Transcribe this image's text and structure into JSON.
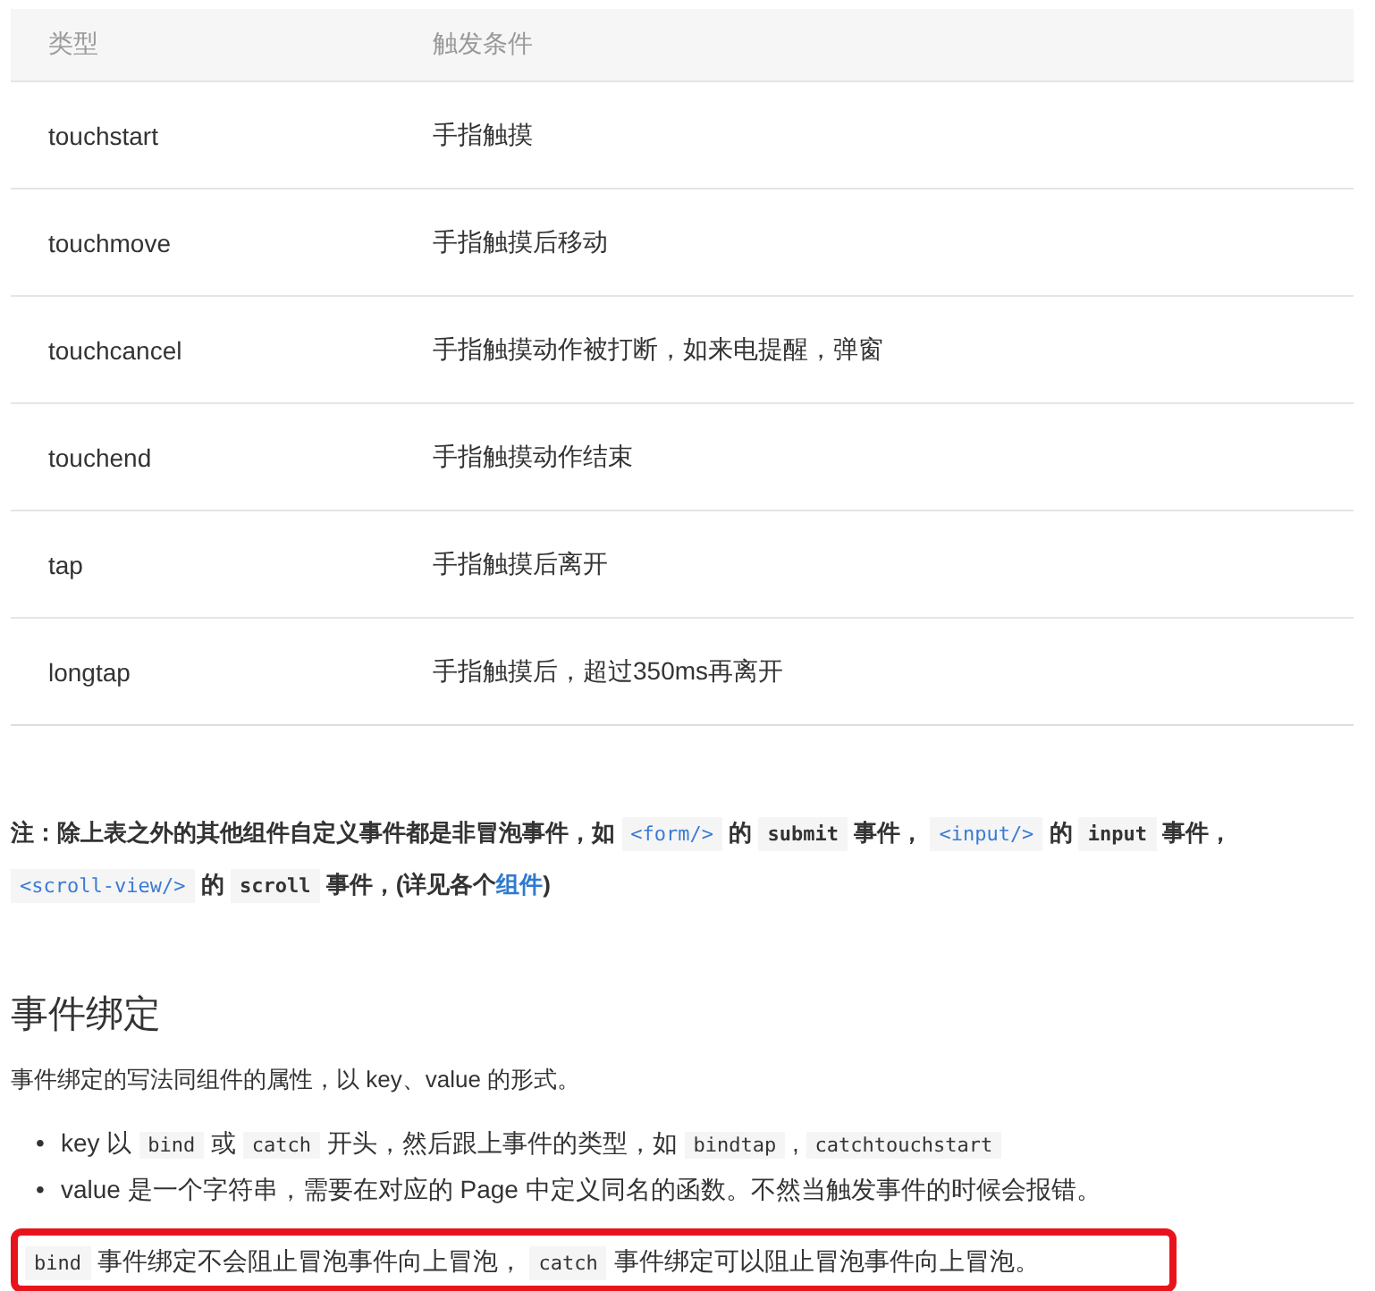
{
  "table": {
    "columns": [
      "类型",
      "触发条件"
    ],
    "rows": [
      [
        "touchstart",
        "手指触摸"
      ],
      [
        "touchmove",
        "手指触摸后移动"
      ],
      [
        "touchcancel",
        "手指触摸动作被打断，如来电提醒，弹窗"
      ],
      [
        "touchend",
        "手指触摸动作结束"
      ],
      [
        "tap",
        "手指触摸后离开"
      ],
      [
        "longtap",
        "手指触摸后，超过350ms再离开"
      ]
    ]
  },
  "note": [
    {
      "kind": "text",
      "text": "注：除上表之外的其他组件自定义事件都是非冒泡事件，如 "
    },
    {
      "kind": "tag",
      "text": "<form/>"
    },
    {
      "kind": "text",
      "text": " 的 "
    },
    {
      "kind": "code",
      "text": "submit"
    },
    {
      "kind": "text",
      "text": " 事件， "
    },
    {
      "kind": "tag",
      "text": "<input/>"
    },
    {
      "kind": "text",
      "text": " 的 "
    },
    {
      "kind": "code",
      "text": "input"
    },
    {
      "kind": "text",
      "text": " 事件， "
    },
    {
      "kind": "tag",
      "text": "<scroll-view/>"
    },
    {
      "kind": "text",
      "text": " 的 "
    },
    {
      "kind": "code",
      "text": "scroll"
    },
    {
      "kind": "text",
      "text": " 事件，(详见各个"
    },
    {
      "kind": "link",
      "text": "组件"
    },
    {
      "kind": "text",
      "text": ")"
    }
  ],
  "heading": "事件绑定",
  "intro": "事件绑定的写法同组件的属性，以 key、value 的形式。",
  "bullets": [
    {
      "marker": "•",
      "parts": [
        {
          "kind": "text",
          "text": "key 以 "
        },
        {
          "kind": "code",
          "text": "bind"
        },
        {
          "kind": "text",
          "text": " 或 "
        },
        {
          "kind": "code",
          "text": "catch"
        },
        {
          "kind": "text",
          "text": " 开头，然后跟上事件的类型，如 "
        },
        {
          "kind": "code",
          "text": "bindtap"
        },
        {
          "kind": "text",
          "text": " , "
        },
        {
          "kind": "code",
          "text": "catchtouchstart"
        }
      ]
    },
    {
      "marker": "•",
      "parts": [
        {
          "kind": "text",
          "text": "value 是一个字符串，需要在对应的 Page 中定义同名的函数。不然当触发事件的时候会报错。"
        }
      ]
    }
  ],
  "highlighted": [
    {
      "kind": "code",
      "text": "bind"
    },
    {
      "kind": "text",
      "text": " 事件绑定不会阻止冒泡事件向上冒泡， "
    },
    {
      "kind": "code",
      "text": "catch"
    },
    {
      "kind": "text",
      "text": " 事件绑定可以阻止冒泡事件向上冒泡。"
    }
  ]
}
